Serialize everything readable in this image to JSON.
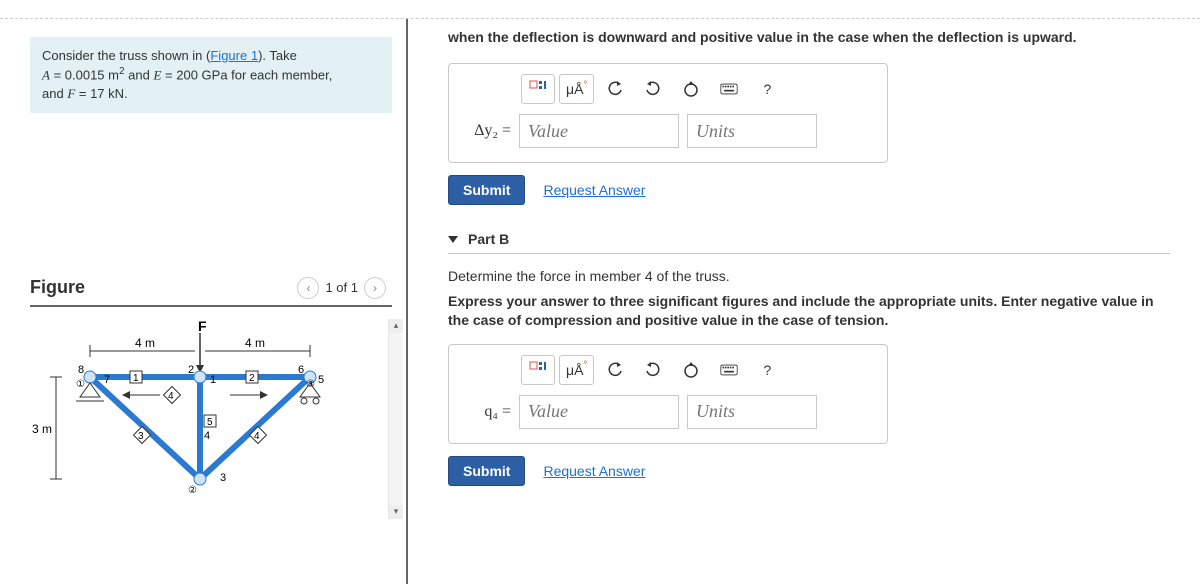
{
  "problem": {
    "pre": "Consider the truss shown in (",
    "fig_link": "Figure 1",
    "post": "). Take",
    "line2_pre": "A",
    "line2_eq": " = 0.0015 m",
    "line2_sup": "2",
    "line2_and": " and ",
    "line2_E": "E",
    "line2_Eval": " = 200 GPa for each member,",
    "line3_pre": "and ",
    "line3_F": "F",
    "line3_val": " = 17 kN."
  },
  "figure": {
    "title": "Figure",
    "pager": "1 of 1",
    "truss": {
      "F_label": "F",
      "dim_top_left": "4 m",
      "dim_top_right": "4 m",
      "dim_height": "3 m",
      "node_labels": [
        "1",
        "2",
        "3"
      ],
      "member_labels": [
        "1",
        "2",
        "3",
        "4",
        "5",
        "6",
        "7",
        "8"
      ],
      "small_nums": [
        "1",
        "2",
        "3",
        "4",
        "5"
      ]
    }
  },
  "partA": {
    "top_text": "when the deflection is downward and positive value in the case when the deflection is upward.",
    "label": "Δy₂ =",
    "value_ph": "Value",
    "units_ph": "Units",
    "submit": "Submit",
    "request": "Request Answer",
    "tool_mu": "μÅ",
    "tool_q": "?"
  },
  "partB": {
    "heading": "Part B",
    "desc": "Determine the force in member 4 of the truss.",
    "instr": "Express your answer to three significant figures and include the appropriate units. Enter negative value in the case of compression and positive value in the case of tension.",
    "label": "q₄ =",
    "value_ph": "Value",
    "units_ph": "Units",
    "submit": "Submit",
    "request": "Request Answer",
    "tool_mu": "μÅ",
    "tool_q": "?"
  }
}
